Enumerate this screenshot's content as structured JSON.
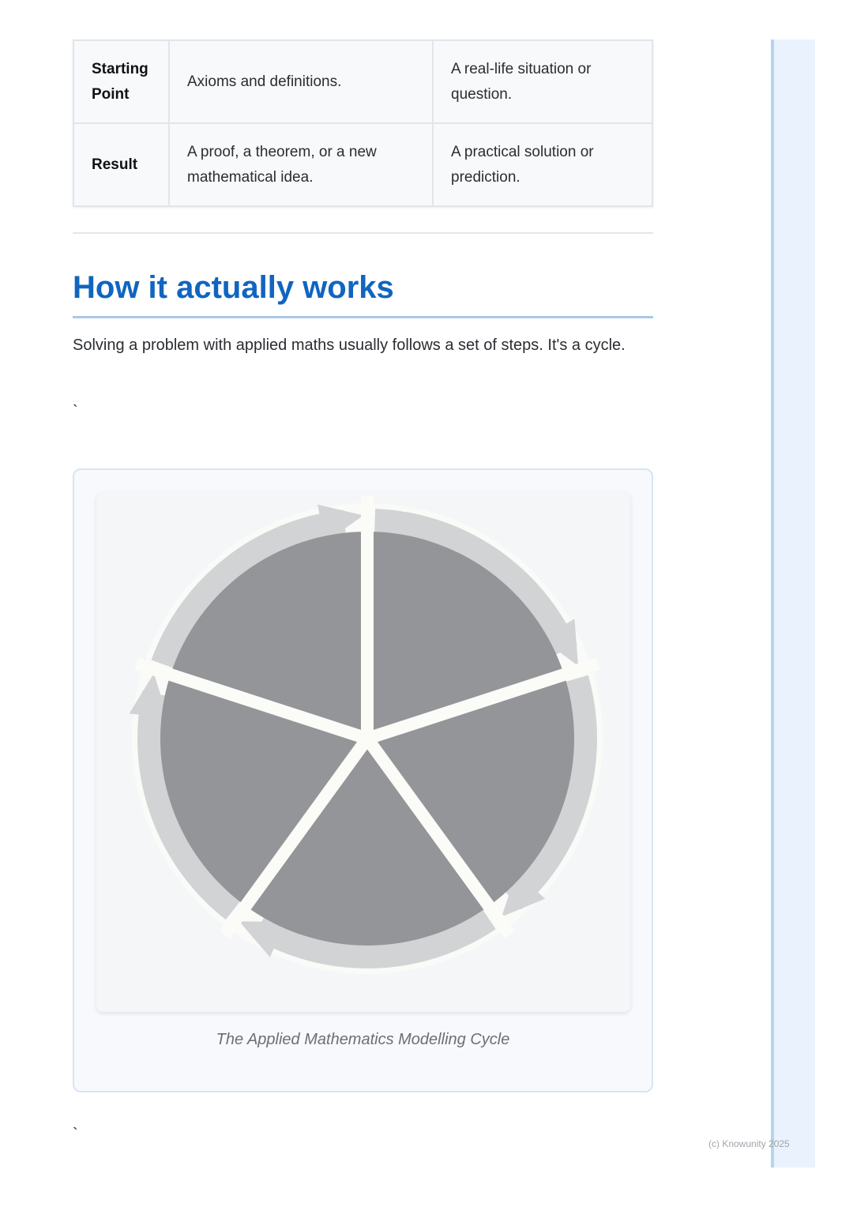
{
  "comparison_table": {
    "rows": [
      {
        "label": "Starting Point",
        "pure": "Axioms and definitions.",
        "applied": "A real-life situation or question."
      },
      {
        "label": "Result",
        "pure": "A proof, a theorem, or a new mathematical idea.",
        "applied": "A practical solution or prediction."
      }
    ]
  },
  "section": {
    "heading": "How it actually works",
    "intro": "Solving a problem with applied maths usually follows a set of steps. It's a cycle.",
    "tick_1": "`",
    "tick_2": "`"
  },
  "figure": {
    "caption": "The Applied Mathematics Modelling Cycle",
    "segment_count": 5,
    "colors": {
      "segment": "#939598",
      "arrow": "#d1d3d5",
      "gap": "#fbfbf7"
    }
  },
  "footer": {
    "copyright": "(c) Knowunity 2025"
  }
}
